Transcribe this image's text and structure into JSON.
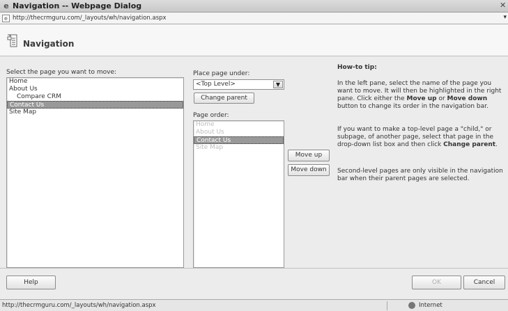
{
  "window": {
    "title": "Navigation -- Webpage Dialog",
    "url": "http://thecrmguru.com/_layouts/wh/navigation.aspx"
  },
  "header": {
    "title": "Navigation"
  },
  "left": {
    "label": "Select the page you want to move:",
    "items": [
      "Home",
      "About Us",
      "Compare CRM",
      "Contact Us",
      "Site Map"
    ],
    "selected": "Contact Us"
  },
  "middle": {
    "place_label": "Place page under:",
    "place_value": "<Top Level>",
    "change_parent": "Change parent",
    "order_label": "Page order:",
    "order_items": [
      "Home",
      "About Us",
      "Contact Us",
      "Site Map"
    ],
    "order_selected": "Contact Us",
    "move_up": "Move up",
    "move_down": "Move down"
  },
  "tip": {
    "title": "How-to tip:",
    "p1_a": "In the left pane, select the name of the page you want to move. It will then be highlighted in the right pane. Click either the ",
    "p1_b": "Move up",
    "p1_c": " or ",
    "p1_d": "Move down",
    "p1_e": " button to change its order in the navigation bar.",
    "p2_a": "If you want to make a top-level page a \"child,\" or subpage, of another page, select that page in the drop-down list box and then click ",
    "p2_b": "Change parent",
    "p2_c": ".",
    "p3": "Second-level pages are only visible in the navigation bar when their parent pages are selected."
  },
  "footer": {
    "help": "Help",
    "ok": "OK",
    "cancel": "Cancel"
  },
  "status": {
    "url": "http://thecrmguru.com/_layouts/wh/navigation.aspx",
    "zone": "Internet"
  }
}
